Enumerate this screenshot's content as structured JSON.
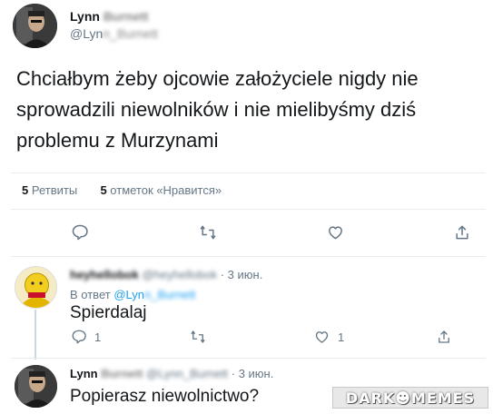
{
  "main_tweet": {
    "author_name": "Lynn",
    "author_surname": "Burnett",
    "author_handle_prefix": "@Lyn",
    "author_handle_suffix": "n_Burnett",
    "text": "Chciałbym żeby ojcowie założyciele nigdy nie sprowadzili niewolników i nie mielibyśmy dziś problemu z Murzynami",
    "retweets_count": "5",
    "retweets_label": "Ретвиты",
    "likes_count": "5",
    "likes_label": "отметок «Нравится»"
  },
  "replies": [
    {
      "author_name": "heyhellobok",
      "author_handle": "@heyhellobok",
      "separator": "·",
      "date": "3 июн.",
      "replying_label": "В ответ",
      "replying_handle_prefix": "@Lyn",
      "replying_handle_suffix": "n_Burnett",
      "text": "Spierdalaj",
      "reply_count": "1",
      "like_count": "1"
    },
    {
      "author_name": "Lynn",
      "author_surname": "Burnett",
      "author_handle": "@Lynn_Burnett",
      "separator": "·",
      "date": "3 июн.",
      "text": "Popierasz niewolnictwo?"
    }
  ],
  "watermark": "DARK☻MEMES",
  "icons": [
    "reply-icon",
    "retweet-icon",
    "like-icon",
    "share-icon"
  ],
  "colors": {
    "accent": "#1da1f2",
    "muted": "#657786",
    "text": "#14171a",
    "divider": "#e6ecf0"
  }
}
